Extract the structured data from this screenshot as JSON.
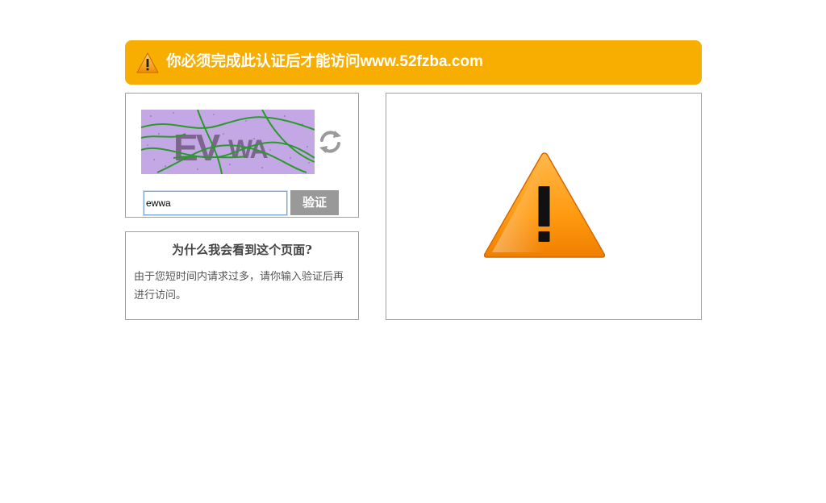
{
  "banner": {
    "message": "你必须完成此认证后才能访问",
    "domain": "www.52fzba.com",
    "icon": "warning-icon",
    "background_color": "#f7ae00"
  },
  "captcha": {
    "image_text": "EVWA",
    "refresh_icon": "refresh-icon",
    "input_value": "ewwa",
    "verify_label": "验证"
  },
  "why": {
    "title": "为什么我会看到这个页面?",
    "body": "由于您短时间内请求过多，请你输入验证后再进行访问。"
  },
  "panel": {
    "icon": "warning-icon"
  }
}
